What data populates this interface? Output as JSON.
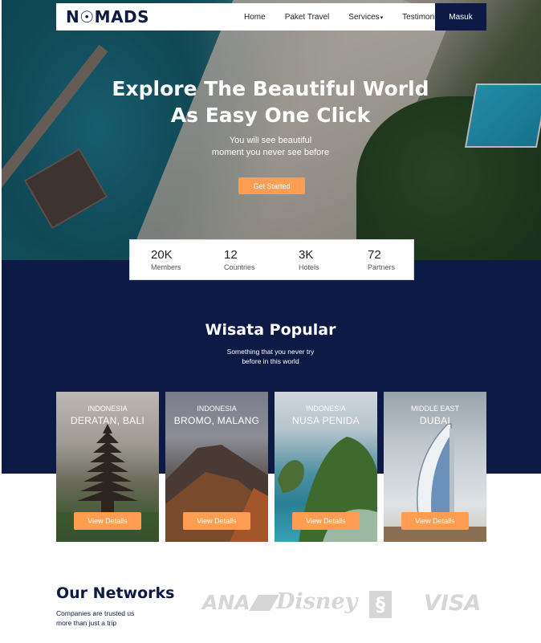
{
  "nav": {
    "logo": "N☉MADS",
    "links": [
      "Home",
      "Paket Travel",
      "Services",
      "Testimonial"
    ],
    "login": "Masuk"
  },
  "hero": {
    "title_line1": "Explore The Beautiful World",
    "title_line2": "As Easy One Click",
    "subtitle_line1": "You will see beautiful",
    "subtitle_line2": "moment you never see before",
    "cta": "Get Started"
  },
  "stats": [
    {
      "value": "20K",
      "label": "Members"
    },
    {
      "value": "12",
      "label": "Countries"
    },
    {
      "value": "3K",
      "label": "Hotels"
    },
    {
      "value": "72",
      "label": "Partners"
    }
  ],
  "popular": {
    "title": "Wisata Popular",
    "subtitle_line1": "Something that you never try",
    "subtitle_line2": "before in this world",
    "cards": [
      {
        "country": "INDONESIA",
        "place": "DERATAN, BALI",
        "button": "View Details"
      },
      {
        "country": "INDONESIA",
        "place": "BROMO, MALANG",
        "button": "View Details"
      },
      {
        "country": "INDONESIA",
        "place": "NUSA PENIDA",
        "button": "View Details"
      },
      {
        "country": "MIDDLE EAST",
        "place": "DUBAI",
        "button": "View Details"
      }
    ]
  },
  "networks": {
    "title": "Our Networks",
    "subtitle_line1": "Companies are trusted us",
    "subtitle_line2": "more than just a trip",
    "partners": [
      "ANA",
      "Disney",
      "§",
      "VISA"
    ]
  },
  "colors": {
    "navy": "#0c1a45",
    "accent": "#ff9e53",
    "partner_gray": "#d6d6d6"
  }
}
